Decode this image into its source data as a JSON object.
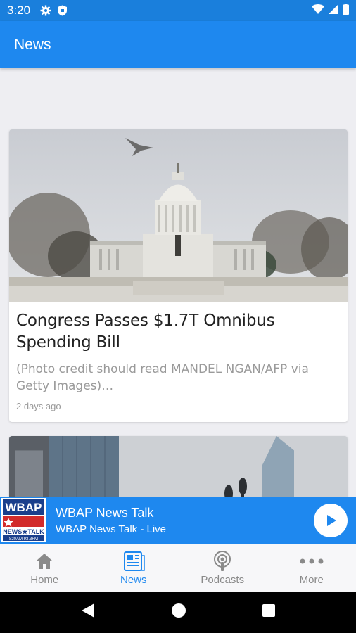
{
  "status_bar": {
    "time": "3:20",
    "left_icons": [
      "gear-icon",
      "shield-icon"
    ],
    "right_icons": [
      "wifi-icon",
      "cell-signal-icon",
      "battery-icon"
    ]
  },
  "app_bar": {
    "title": "News"
  },
  "articles": [
    {
      "title": "Congress Passes $1.7T Omnibus Spending Bill",
      "description": "(Photo credit should read MANDEL NGAN/AFP via Getty Images)…",
      "date": "2 days ago",
      "image": "capitol-building-photo"
    },
    {
      "title": "",
      "image": "city-skyline-photo"
    }
  ],
  "player": {
    "logo_text": "WBAP",
    "logo_sub": "NEWS★TALK",
    "logo_freq": "820AM 93.3FM",
    "title": "WBAP News Talk",
    "subtitle": "WBAP News Talk - Live",
    "action_icon": "play-icon"
  },
  "bottom_nav": [
    {
      "label": "Home",
      "icon": "home-icon",
      "active": false
    },
    {
      "label": "News",
      "icon": "news-icon",
      "active": true
    },
    {
      "label": "Podcasts",
      "icon": "podcast-icon",
      "active": false
    },
    {
      "label": "More",
      "icon": "more-icon",
      "active": false
    }
  ],
  "colors": {
    "primary": "#1e88ef",
    "status_bar": "#1a7fdc",
    "background": "#eeeef2",
    "inactive": "#8a8a8a"
  }
}
